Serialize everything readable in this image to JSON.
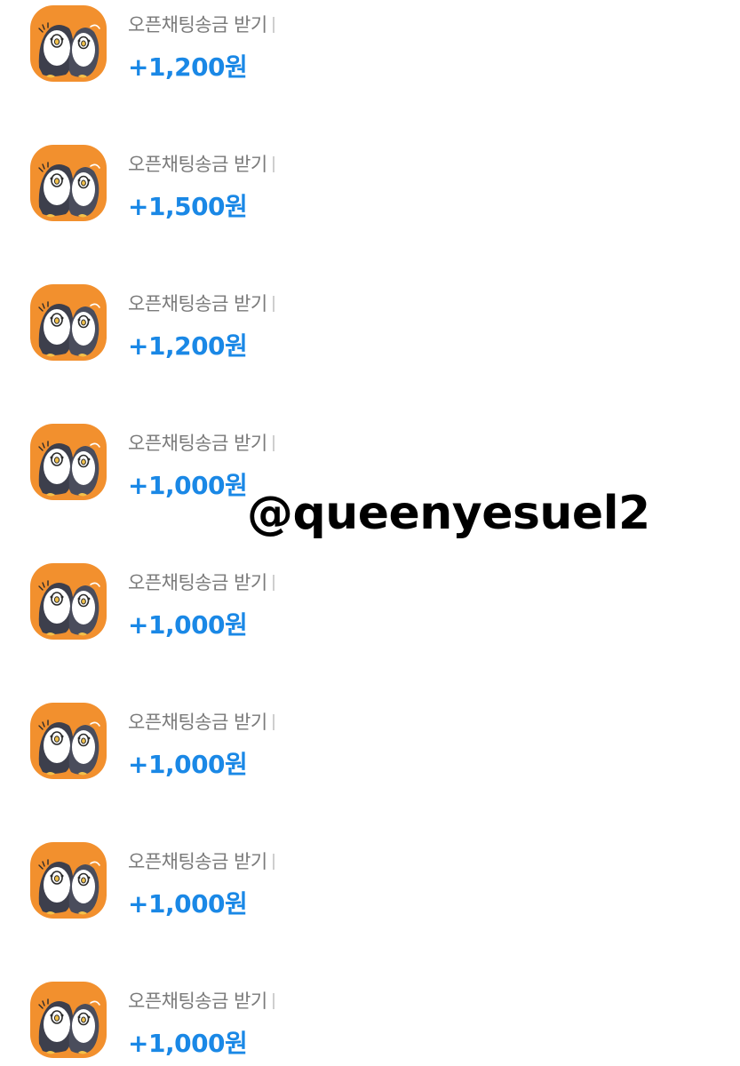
{
  "transactions": [
    {
      "description": "오픈채팅송금 받기",
      "amount": "+1,200원",
      "avatar_icon": "penguin-pair-icon"
    },
    {
      "description": "오픈채팅송금 받기",
      "amount": "+1,500원",
      "avatar_icon": "penguin-pair-icon"
    },
    {
      "description": "오픈채팅송금 받기",
      "amount": "+1,200원",
      "avatar_icon": "penguin-pair-icon"
    },
    {
      "description": "오픈채팅송금 받기",
      "amount": "+1,000원",
      "avatar_icon": "penguin-pair-icon"
    },
    {
      "description": "오픈채팅송금 받기",
      "amount": "+1,000원",
      "avatar_icon": "penguin-pair-icon"
    },
    {
      "description": "오픈채팅송금 받기",
      "amount": "+1,000원",
      "avatar_icon": "penguin-pair-icon"
    },
    {
      "description": "오픈채팅송금 받기",
      "amount": "+1,000원",
      "avatar_icon": "penguin-pair-icon"
    },
    {
      "description": "오픈채팅송금 받기",
      "amount": "+1,000원",
      "avatar_icon": "penguin-pair-icon"
    }
  ],
  "watermark": "@queenyesuel2",
  "colors": {
    "amount": "#1a88e6",
    "description": "#7a7a7a",
    "avatar_bg": "#f2902e",
    "watermark": "#000000"
  }
}
